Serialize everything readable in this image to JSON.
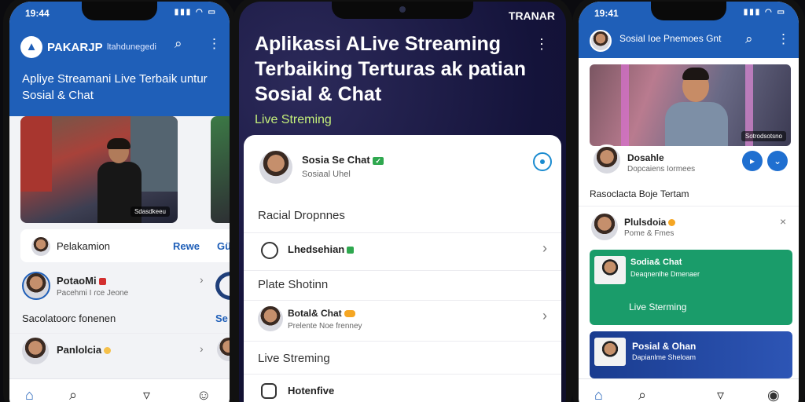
{
  "phone1": {
    "status_time": "19:44",
    "status_icons": "▮▮▮ ◠ ▭",
    "brand": "PAKARJP",
    "brand_sub": "ltahdunegedi",
    "title": "Apliye Streamani Live Terbaik untur Sosial & Chat",
    "hero_tag": "Sdasdkeeu",
    "host_name": "Pelakamion",
    "action_1": "Rewe",
    "action_2": "Gü",
    "user1_name": "PotaoMi",
    "user1_sub": "Pacehmi I ɾce Jeone",
    "section": "Sacolatoorc fonenen",
    "section_action": "Se",
    "user2_name": "Panlolcia"
  },
  "phone2": {
    "brand": "TRANAR",
    "title": "Aplikassi ALive Streaming Terbaiking Terturas ak patian Sosial & Chat",
    "subtitle": "Live Streming",
    "profile_name": "Sosia Se Chat",
    "profile_badge": "✓",
    "profile_sub": "Sosiaal Uhel",
    "section1": "Racial Dropnnes",
    "item1": "Lhedsehian",
    "section2": "Plate Shotinn",
    "item2_name": "Botal& Chat",
    "item2_sub": "Prelente Noe frenney",
    "section3": "Live Streming",
    "item3": "Hotenfive"
  },
  "phone3": {
    "status_time": "19:41",
    "title": "Sosial Ioe Pnemoes Gnt",
    "video_tag": "Sotrodsotsno",
    "host_name": "Dosahle",
    "host_sub": "Dopcaiens Iormees",
    "section": "Rasoclacta Boje Tertam",
    "card1_name": "Plulsdoia",
    "card1_sub": "Pome & Fmes",
    "card2_title": "Sodia& Chat",
    "card2_sub": "Deaqnenlhe Dmenaer",
    "card2_live": "Live Sterming",
    "card3_title": "Posial & Ohan",
    "card3_sub": "Dapianlme Sheloam"
  },
  "colors": {
    "brand_blue": "#1f5fb8",
    "dark_bg": "#14133a",
    "accent_green": "#1a9c6a",
    "live_green": "#c4ef7a"
  }
}
